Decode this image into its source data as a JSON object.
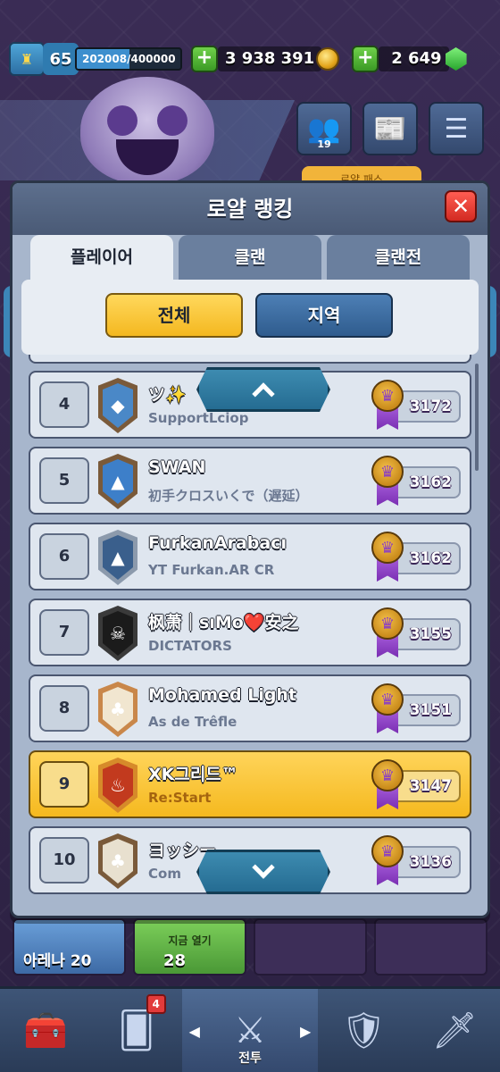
{
  "hud": {
    "level": "65",
    "xp_text": "202008/400000",
    "xp_fraction": 0.505,
    "gold": "3 938 391",
    "gems": "2 649"
  },
  "topbar": {
    "friends_count": "19",
    "pass_label": "로얄 패스"
  },
  "modal": {
    "title": "로얄 랭킹",
    "tabs": [
      {
        "label": "플레이어",
        "active": true
      },
      {
        "label": "클랜",
        "active": false
      },
      {
        "label": "클랜전",
        "active": false
      }
    ],
    "filters": {
      "all": "전체",
      "region": "지역"
    }
  },
  "rows": [
    {
      "rank": "4",
      "name": "ツ✨",
      "clan": "SupportLciop",
      "trophies": "3172",
      "badge_color": "#7a5a3a",
      "badge_inner": "#4a88c7",
      "badge_icon": "◆",
      "highlight": false
    },
    {
      "rank": "5",
      "name": "SWAN",
      "clan": "初手クロスいくで（遅延）",
      "trophies": "3162",
      "badge_color": "#7a5a3a",
      "badge_inner": "#3d7fc9",
      "badge_icon": "▲",
      "highlight": false
    },
    {
      "rank": "6",
      "name": "FurkanArabacı",
      "clan": "YT Furkan.AR CR",
      "trophies": "3162",
      "badge_color": "#8c9aac",
      "badge_inner": "#3a5f8c",
      "badge_icon": "▲",
      "highlight": false
    },
    {
      "rank": "7",
      "name": "枫萧｜sıMo❤️安之",
      "clan": "DICTATORS",
      "trophies": "3155",
      "badge_color": "#3a3a3a",
      "badge_inner": "#1b1b1b",
      "badge_icon": "☠",
      "highlight": false
    },
    {
      "rank": "8",
      "name": "Mohamed Light",
      "clan": "As de Trêfle",
      "trophies": "3151",
      "badge_color": "#c9874a",
      "badge_inner": "#f1e6d0",
      "badge_icon": "♣",
      "highlight": false
    },
    {
      "rank": "9",
      "name": "XK그리드™",
      "clan": "Re:Start",
      "trophies": "3147",
      "badge_color": "#d68a2a",
      "badge_inner": "#c23a1e",
      "badge_icon": "♨",
      "highlight": true
    },
    {
      "rank": "10",
      "name": "ヨッシー",
      "clan": "Com",
      "trophies": "3136",
      "badge_color": "#7a5a3a",
      "badge_inner": "#e8e0cf",
      "badge_icon": "♣",
      "highlight": false
    }
  ],
  "chests": {
    "arena_label": "아레나 20",
    "open_label": "지금 열기",
    "open_cost": "28"
  },
  "nav": {
    "cards_badge": "4",
    "battle_label": "전투"
  },
  "colors": {
    "accent_yellow": "#f4b820",
    "modal_bg": "#a7b6cc",
    "close_red": "#d22a22"
  }
}
